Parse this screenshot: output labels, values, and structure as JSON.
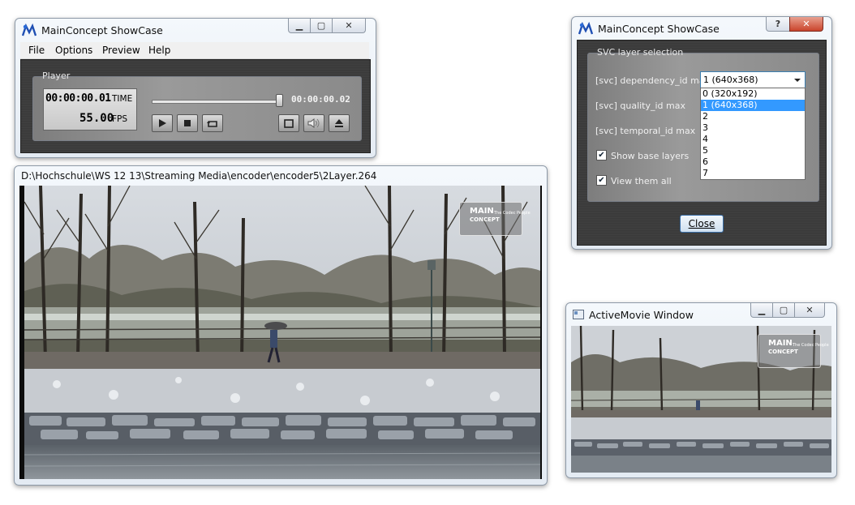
{
  "player_window": {
    "title": "MainConcept ShowCase",
    "menu": [
      "File",
      "Options",
      "Preview",
      "Help"
    ],
    "group_label": "Player",
    "time_value": "00:00:00.01",
    "time_label": "TIME",
    "fps_value": "55.00",
    "fps_label": "FPS",
    "position_time": "00:00:00.02",
    "seek_progress": 0.98
  },
  "video_window": {
    "path": "D:\\Hochschule\\WS 12 13\\Streaming Media\\encoder\\encoder5\\2Layer.264",
    "watermark": {
      "brand": "MAIN",
      "brand2": "CONCEPT",
      "tagline": "The Codec People"
    }
  },
  "svc_dialog": {
    "title": "MainConcept ShowCase",
    "help_button": "?",
    "group_label": "SVC layer selection",
    "dependency_label": "[svc] dependency_id max",
    "dependency_selected": "1 (640x368)",
    "dependency_options": [
      "0 (320x192)",
      "1 (640x368)",
      "2",
      "3",
      "4",
      "5",
      "6",
      "7"
    ],
    "dependency_highlight_index": 1,
    "quality_label": "[svc] quality_id max",
    "temporal_label": "[svc] temporal_id max",
    "show_base_label": "Show base layers",
    "show_base_checked": true,
    "view_all_label": "View them all",
    "view_all_checked": true,
    "close_button": "Close"
  },
  "activemovie_window": {
    "title": "ActiveMovie Window",
    "watermark": {
      "brand": "MAIN",
      "brand2": "CONCEPT",
      "tagline": "The Codec People"
    }
  },
  "colors": {
    "dark_panel": "#3d3d3d",
    "selection": "#3399ff",
    "close_cap": "#c9442b"
  },
  "icons": [
    "mainconcept-logo-icon",
    "minimize-icon",
    "maximize-icon",
    "close-icon",
    "play-icon",
    "stop-icon",
    "loop-icon",
    "fullscreen-icon",
    "volume-icon",
    "eject-icon",
    "dropdown-arrow-icon",
    "activemovie-icon"
  ]
}
